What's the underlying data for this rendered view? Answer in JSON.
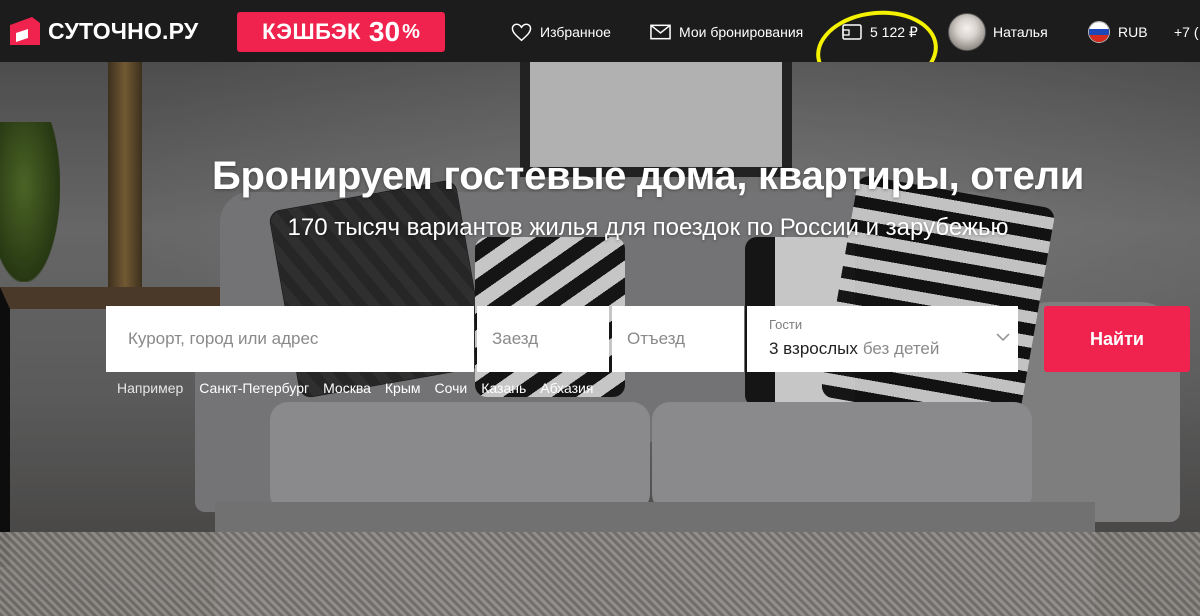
{
  "header": {
    "logo_text": "СУТОЧНО.РУ",
    "cashback": {
      "label": "КЭШБЭК",
      "number": "30",
      "percent": "%"
    },
    "favorites": "Избранное",
    "bookings": "Мои бронирования",
    "balance": "5 122 ₽",
    "user_name": "Наталья",
    "currency": "RUB",
    "phone_partial": "+7 (",
    "icons": [
      "logo-icon",
      "heart-icon",
      "envelope-icon",
      "wallet-icon",
      "avatar",
      "russia-flag-icon"
    ]
  },
  "hero": {
    "title": "Бронируем гостевые дома, квартиры, отели",
    "subtitle": "170 тысяч вариантов жилья для поездок по России и зарубежью"
  },
  "search": {
    "place_placeholder": "Курорт, город или адрес",
    "checkin_placeholder": "Заезд",
    "checkout_placeholder": "Отъезд",
    "guests_label": "Гости",
    "guests_adults": "3 взрослых",
    "guests_children": "без детей",
    "submit": "Найти"
  },
  "examples": {
    "label": "Например",
    "cities": [
      "Санкт-Петербург",
      "Москва",
      "Крым",
      "Сочи",
      "Казань",
      "Абхазия"
    ]
  },
  "colors": {
    "brand": "#f0224e",
    "header_bg": "#1c1c1c",
    "annotation": "#f4f200"
  }
}
